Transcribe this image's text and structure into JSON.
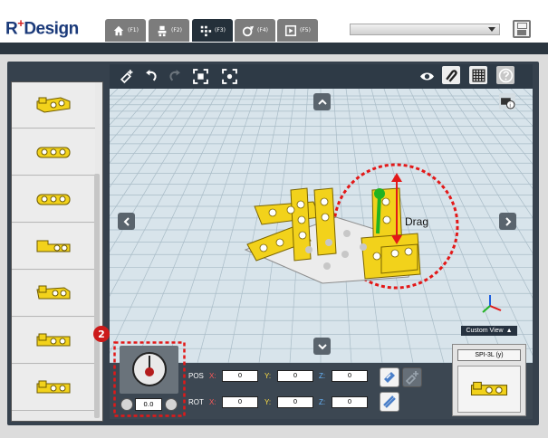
{
  "app": {
    "logo_prefix": "R",
    "logo_plus": "+",
    "logo_suffix": "Design"
  },
  "tabs": [
    {
      "icon": "home-icon",
      "label": "(F1)"
    },
    {
      "icon": "assembly-icon",
      "label": "(F2)"
    },
    {
      "icon": "parts-grid-icon",
      "label": "(F3)"
    },
    {
      "icon": "motion-icon",
      "label": "(F4)"
    },
    {
      "icon": "play-icon",
      "label": "(F5)"
    }
  ],
  "active_tab_index": 2,
  "model_select": {
    "value": ""
  },
  "viewport": {
    "drag_label": "Drag",
    "custom_view_label": "Custom View",
    "custom_view_arrow": "▲"
  },
  "rotation": {
    "callout_number": "2",
    "value": "0.0"
  },
  "position": {
    "label": "POS",
    "x_label": "X",
    "x_value": "0",
    "y_label": "Y",
    "y_value": "0",
    "z_label": "Z",
    "z_value": "0",
    "separator": ":"
  },
  "rotation_fields": {
    "label": "ROT",
    "x_label": "X",
    "x_value": "0",
    "y_label": "Y",
    "y_value": "0",
    "z_label": "Z",
    "z_value": "0",
    "separator": ":"
  },
  "part_info": {
    "name": "SPI-3L (y)"
  },
  "colors": {
    "accent_red": "#cc1a1a",
    "part_yellow": "#f2d21b",
    "dark_panel": "#36414d",
    "grid_bg": "#d6e3ea"
  }
}
